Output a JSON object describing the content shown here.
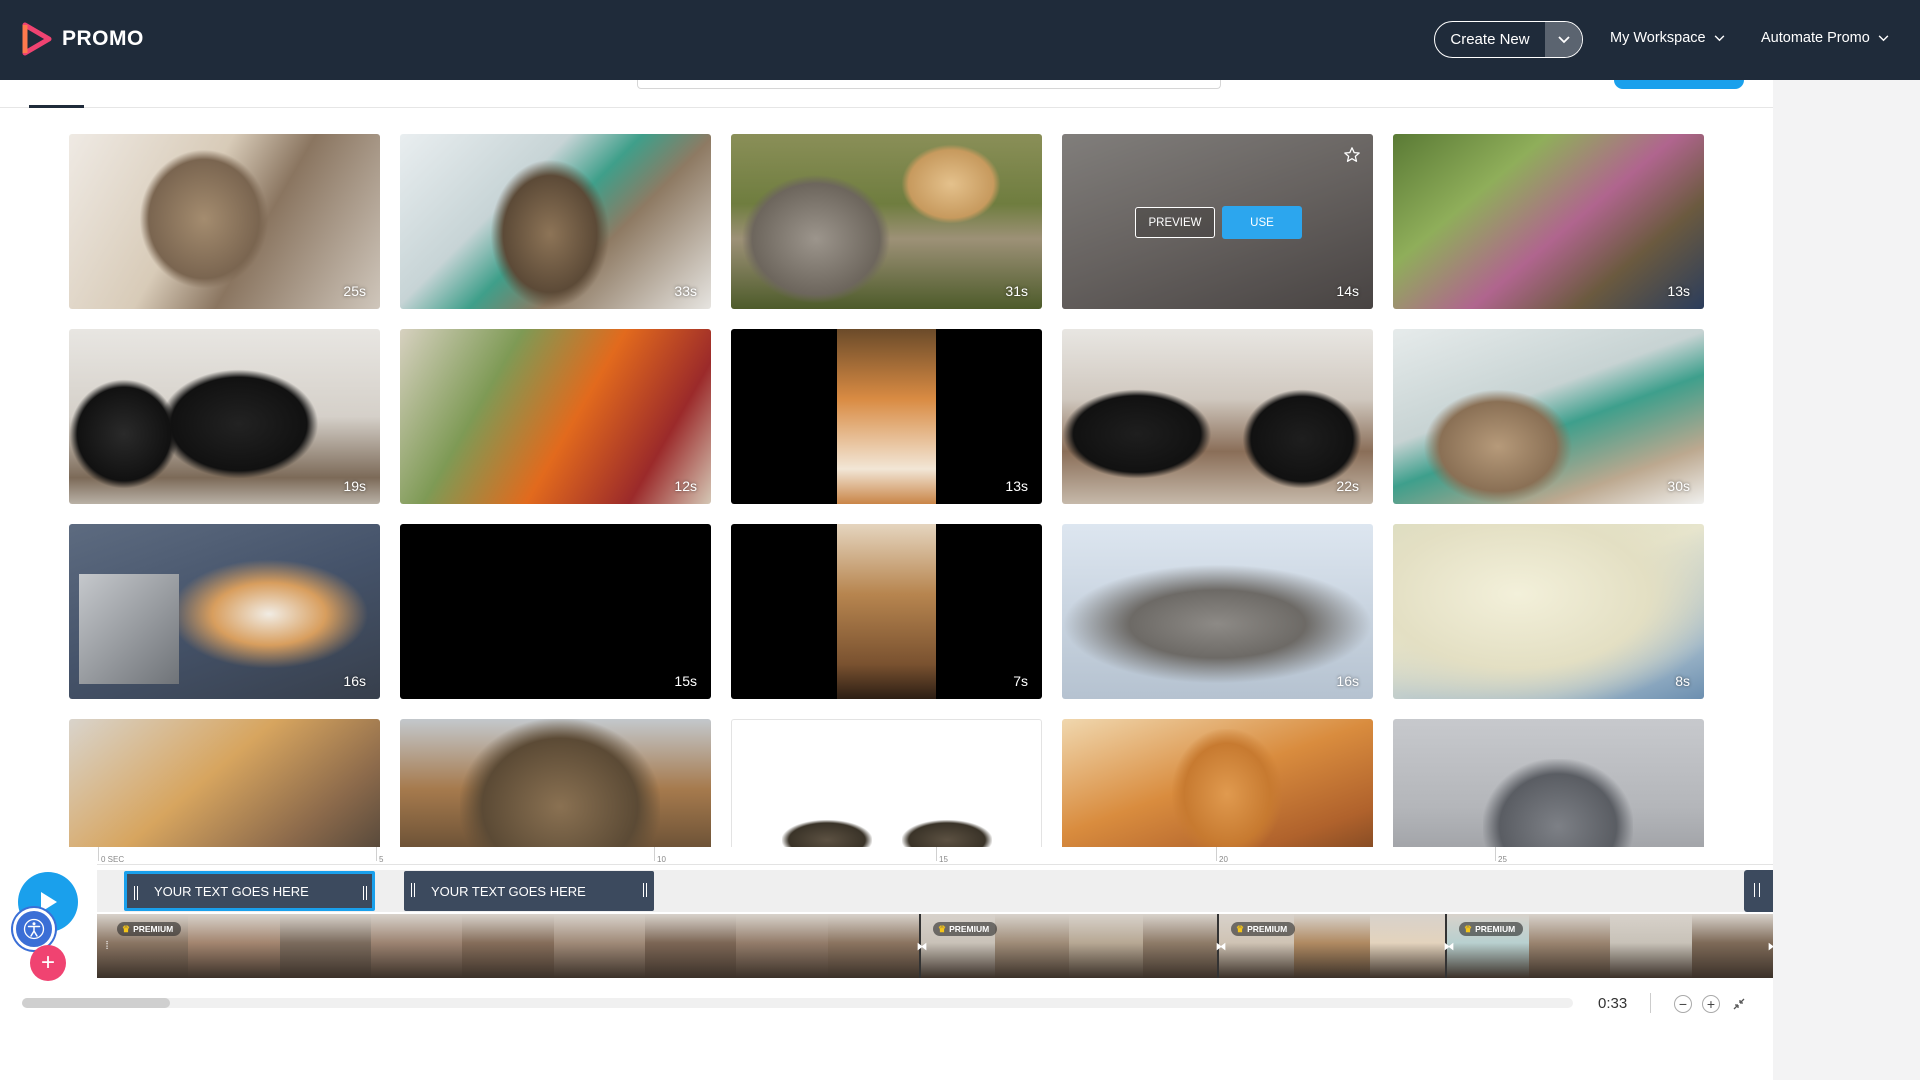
{
  "header": {
    "logo_text": "PROMO",
    "create_new": "Create New",
    "my_workspace": "My Workspace",
    "automate_promo": "Automate Promo"
  },
  "grid": {
    "tiles": [
      {
        "duration": "25s",
        "scene": "cat held by person, light background"
      },
      {
        "duration": "33s",
        "scene": "vet clinic with cat"
      },
      {
        "duration": "31s",
        "scene": "cats in garden"
      },
      {
        "duration": "14s",
        "scene": "hovered tile",
        "hover": true
      },
      {
        "duration": "13s",
        "scene": "woman with cat in garden"
      },
      {
        "duration": "19s",
        "scene": "black cats in snow"
      },
      {
        "duration": "12s",
        "scene": "woman with cat at home"
      },
      {
        "duration": "13s",
        "scene": "ginger cat vertical video"
      },
      {
        "duration": "22s",
        "scene": "black cats on porch"
      },
      {
        "duration": "30s",
        "scene": "vet with fluffy cat"
      },
      {
        "duration": "16s",
        "scene": "cat with laptop"
      },
      {
        "duration": "15s",
        "scene": "black video"
      },
      {
        "duration": "7s",
        "scene": "cat looking up vertical video"
      },
      {
        "duration": "16s",
        "scene": "tabby kitten lying"
      },
      {
        "duration": "8s",
        "scene": "white fluffy cats"
      },
      {
        "duration": "",
        "scene": "cat and keyboard"
      },
      {
        "duration": "",
        "scene": "tabby cat closeup"
      },
      {
        "duration": "",
        "scene": "cat on white background"
      },
      {
        "duration": "",
        "scene": "ginger kitten indoors"
      },
      {
        "duration": "",
        "scene": "grey cat"
      }
    ],
    "hover_preview": "PREVIEW",
    "hover_use": "USE",
    "star_icon": "star-outline-icon"
  },
  "timeline": {
    "ruler": [
      "0 SEC",
      "5",
      "10",
      "15",
      "20",
      "25"
    ],
    "text_clips": [
      "YOUR TEXT GOES HERE",
      "YOUR TEXT GOES HERE"
    ],
    "premium_label": "PREMIUM",
    "total_duration": "0:33",
    "zoom_out": "−",
    "zoom_in": "+"
  },
  "colors": {
    "topbar": "#1f2b3a",
    "accent_blue": "#1aa0ec",
    "accent_pink": "#f04371",
    "clip_navy": "#3c4a5e"
  }
}
